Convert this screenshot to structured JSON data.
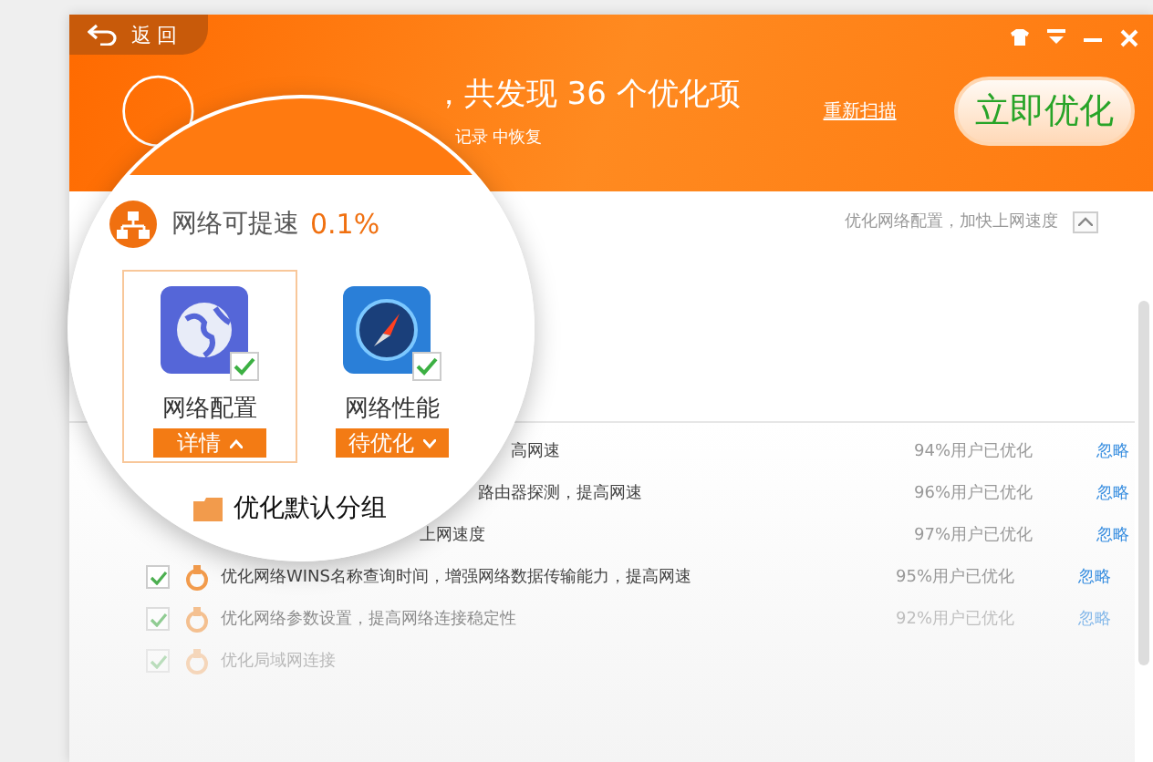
{
  "header": {
    "back": "返回",
    "title": "，共发现 36 个优化项",
    "subtitle": "记录 中恢复",
    "rescan": "重新扫描",
    "optimize": "立即优化"
  },
  "section": {
    "hint": "优化网络配置，加快上网速度",
    "expanded": true
  },
  "rows": [
    {
      "kind": "covered",
      "text": "高网速",
      "share": "94%用户已优化",
      "ignore": "忽略"
    },
    {
      "kind": "covered",
      "text": "路由器探测，提高网速",
      "share": "96%用户已优化",
      "ignore": "忽略"
    },
    {
      "kind": "covered",
      "text": "上网速度",
      "share": "97%用户已优化",
      "ignore": "忽略"
    },
    {
      "kind": "full",
      "checked": true,
      "text": "优化网络WINS名称查询时间，增强网络数据传输能力，提高网速",
      "share": "95%用户已优化",
      "ignore": "忽略"
    },
    {
      "kind": "full",
      "checked": true,
      "text": "优化网络参数设置，提高网络连接稳定性",
      "share": "92%用户已优化",
      "ignore": "忽略"
    },
    {
      "kind": "full",
      "checked": true,
      "text": "优化局域网连接"
    }
  ],
  "magnifier": {
    "title": "网络可提速",
    "value": "0.1%",
    "bottom_label": "优化默认分组",
    "items": [
      {
        "kind": "globe",
        "name": "网络配置",
        "action": "详情",
        "checked": true,
        "selected": true,
        "expanded": true
      },
      {
        "kind": "gauge",
        "name": "网络性能",
        "action": "待优化",
        "checked": true,
        "selected": false,
        "expanded": false
      }
    ]
  }
}
